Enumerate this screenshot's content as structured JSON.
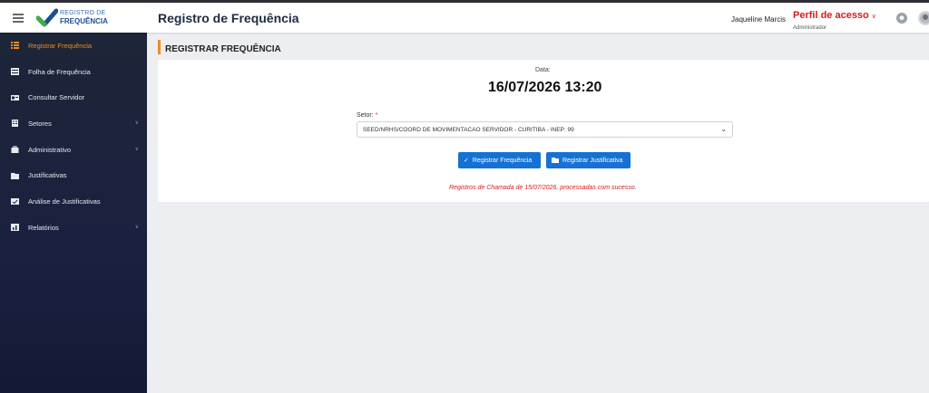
{
  "header": {
    "logo_line1": "REGISTRO DE",
    "logo_line2": "FREQUÊNCIA",
    "title": "Registro de Frequência",
    "user_name": "Jaqueline Marcis",
    "profile_title": "Perfil de acesso",
    "profile_role": "Administrador",
    "accent_color": "#d81a1a"
  },
  "sidebar": {
    "items": [
      {
        "label": "Registrar Frequência",
        "icon": "list-check-icon",
        "active": true
      },
      {
        "label": "Folha de Frequência",
        "icon": "table-icon"
      },
      {
        "label": "Consultar Servidor",
        "icon": "id-card-icon"
      },
      {
        "label": "Setores",
        "icon": "building-icon",
        "has_submenu": true
      },
      {
        "label": "Administrativo",
        "icon": "briefcase-icon",
        "has_submenu": true
      },
      {
        "label": "Justificativas",
        "icon": "folder-icon"
      },
      {
        "label": "Análise de Justificativas",
        "icon": "calendar-check-icon"
      },
      {
        "label": "Relatórios",
        "icon": "report-icon",
        "has_submenu": true
      }
    ],
    "active_color": "#f08a24"
  },
  "main": {
    "section_title": "REGISTRAR FREQUÊNCIA",
    "date_label": "Data:",
    "date_value": "16/07/2026 13:20",
    "setor_label": "Setor:",
    "setor_required": "*",
    "setor_value": "SEED/NRHS/COORD DE MOVIMENTACAO SERVIDOR - CURITIBA - INEP: 99",
    "btn_register": "Registrar Frequência",
    "btn_justify": "Registrar Justificativa",
    "message": "Registros de Chamada de 15/07/2026, processadas com sucesso."
  }
}
